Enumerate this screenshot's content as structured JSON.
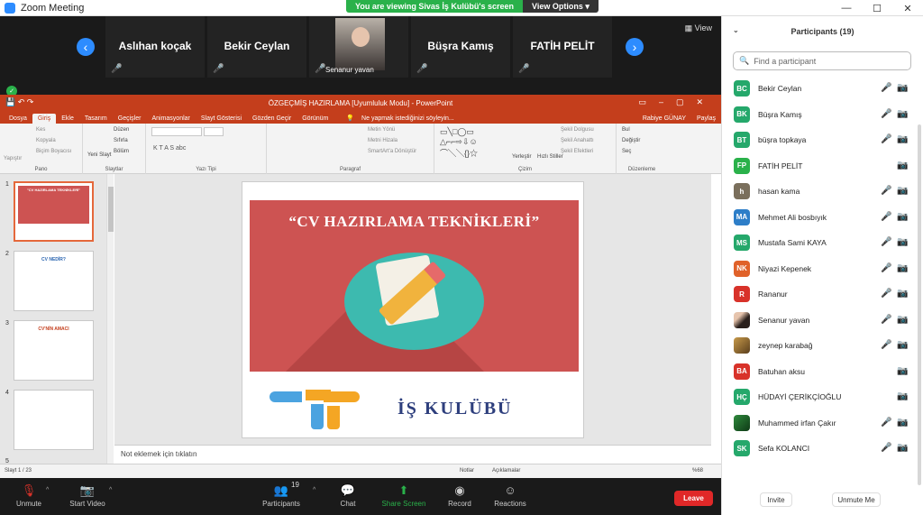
{
  "window": {
    "title": "Zoom Meeting",
    "minimize": "—",
    "maximize": "☐",
    "close": "✕"
  },
  "share_banner": {
    "text": "You are viewing Sivas İş Kulübü's screen",
    "options": "View Options ▾"
  },
  "video_strip": {
    "tiles": [
      {
        "name": "Aslıhan koçak"
      },
      {
        "name": "Bekir Ceylan"
      },
      {
        "name": "Senanur yavan"
      },
      {
        "name": "Büşra Kamış"
      },
      {
        "name": "FATİH PELİT"
      }
    ],
    "view_label": "View"
  },
  "powerpoint": {
    "title": "ÖZGEÇMİŞ HAZIRLAMA [Uyumluluk Modu] - PowerPoint",
    "tabs": [
      "Dosya",
      "Giriş",
      "Ekle",
      "Tasarım",
      "Geçişler",
      "Animasyonlar",
      "Slayt Gösterisi",
      "Gözden Geçir",
      "Görünüm"
    ],
    "tell_me": "Ne yapmak istediğinizi söyleyin...",
    "user": "Rabiye GÜNAY",
    "share": "Paylaş",
    "ribbon": {
      "pano": "Pano",
      "slaytlar": "Slaytlar",
      "yazi_tipi": "Yazı Tipi",
      "paragraf": "Paragraf",
      "cizim": "Çizim",
      "duzenleme": "Düzenleme",
      "yapistir": "Yapıştır",
      "kes": "Kes",
      "kopyala": "Kopyala",
      "bicim_boyacisi": "Biçim Boyacısı",
      "yeni_slayt": "Yeni Slayt",
      "duzen": "Düzen",
      "sifirla": "Sıfırla",
      "bolum": "Bölüm",
      "metin_yonu": "Metin Yönü",
      "metni_hizala": "Metni Hizala",
      "smartart": "SmartArt'a Dönüştür",
      "yerlestir": "Yerleştir",
      "hizli_stiller": "Hızlı Stiller",
      "sekil_dolgusu": "Şekil Dolgusu",
      "sekil_anahat": "Şekil Anahattı",
      "sekil_efekt": "Şekil Efektleri",
      "bul": "Bul",
      "degistir": "Değiştir",
      "sec": "Seç"
    },
    "thumb_titles": {
      "s1": "\"CV HAZIRLAMA TEKNİKLERİ\"",
      "s2": "CV NEDİR?",
      "s3": "CV'NİN AMACI"
    },
    "slide_numbers": [
      "1",
      "2",
      "3",
      "4",
      "5"
    ],
    "slide": {
      "title": "“CV HAZIRLAMA TEKNİKLERİ”",
      "logo_text": "İŞ KULÜBÜ"
    },
    "notes_placeholder": "Not eklemek için tıklatın",
    "status": {
      "slide": "Slayt 1 / 23",
      "notes": "Notlar",
      "comments": "Açıklamalar",
      "zoom": "%68"
    }
  },
  "toolbar": {
    "unmute": "Unmute",
    "start_video": "Start Video",
    "participants": "Participants",
    "participant_count": "19",
    "chat": "Chat",
    "share_screen": "Share Screen",
    "record": "Record",
    "reactions": "Reactions",
    "leave": "Leave"
  },
  "participants_panel": {
    "title": "Participants (19)",
    "search_placeholder": "Find a participant",
    "items": [
      {
        "initials": "BC",
        "name": "Bekir Ceylan",
        "color": "#25a86b"
      },
      {
        "initials": "BK",
        "name": "Büşra Kamış",
        "color": "#25a86b"
      },
      {
        "initials": "BT",
        "name": "büşra topkaya",
        "color": "#25a86b"
      },
      {
        "initials": "FP",
        "name": "FATİH PELİT",
        "color": "#2ab14a"
      },
      {
        "initials": "h",
        "name": "hasan kama",
        "color": "#7a6f5c"
      },
      {
        "initials": "MA",
        "name": "Mehmet Ali bosbıyık",
        "color": "#2d7ec8"
      },
      {
        "initials": "MS",
        "name": "Mustafa Sami KAYA",
        "color": "#25a86b"
      },
      {
        "initials": "NK",
        "name": "Niyazi Kepenek",
        "color": "#e0622a"
      },
      {
        "initials": "R",
        "name": "Rananur",
        "color": "#d8322a"
      },
      {
        "initials": "",
        "name": "Senanur yavan",
        "color": "#3b302c"
      },
      {
        "initials": "",
        "name": "zeynep karabağ",
        "color": "#8a6a2e"
      },
      {
        "initials": "BA",
        "name": "Batuhan aksu",
        "color": "#d8322a"
      },
      {
        "initials": "HÇ",
        "name": "HÜDAYİ ÇERİKÇİOĞLU",
        "color": "#25a86b"
      },
      {
        "initials": "",
        "name": "Muhammed irfan Çakır",
        "color": "#1e6b2a"
      },
      {
        "initials": "SK",
        "name": "Sefa KOLANCI",
        "color": "#25a86b"
      }
    ],
    "invite": "Invite",
    "unmute_me": "Unmute Me"
  }
}
